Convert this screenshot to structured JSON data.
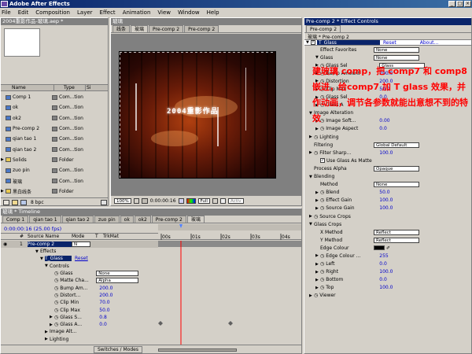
{
  "app": {
    "title": "Adobe After Effects"
  },
  "menu": [
    "File",
    "Edit",
    "Composition",
    "Layer",
    "Effect",
    "Animation",
    "View",
    "Window",
    "Help"
  ],
  "project": {
    "title": "2004重影作品-玻璃.aep *",
    "columns": [
      "Name",
      "Type",
      "Si"
    ],
    "items": [
      {
        "name": "Comp 1",
        "type": "Com...tion",
        "icon": "comp",
        "indent": 0
      },
      {
        "name": "ok",
        "type": "Com...tion",
        "icon": "comp",
        "indent": 0
      },
      {
        "name": "ok2",
        "type": "Com...tion",
        "icon": "comp",
        "indent": 0
      },
      {
        "name": "Pre-comp 2",
        "type": "Com...tion",
        "icon": "comp",
        "indent": 0
      },
      {
        "name": "qian tao 1",
        "type": "Com...tion",
        "icon": "comp",
        "indent": 0
      },
      {
        "name": "qian tao 2",
        "type": "Com...tion",
        "icon": "comp",
        "indent": 0
      },
      {
        "name": "Solids",
        "type": "Folder",
        "icon": "folder",
        "indent": 0
      },
      {
        "name": "zuo pin",
        "type": "Com...tion",
        "icon": "comp",
        "indent": 0
      },
      {
        "name": "玻璃",
        "type": "Com...tion",
        "icon": "comp",
        "indent": 0
      },
      {
        "name": "黑白线条",
        "type": "Folder",
        "icon": "folder",
        "indent": 0
      }
    ],
    "bottom_depth": "8 bpc"
  },
  "comp": {
    "title": "玻璃",
    "tabs": [
      "线条",
      "玻璃",
      "Pre-comp 2",
      "Pre-comp 2"
    ],
    "overlay_text": "2004重影作品",
    "zoom": "100%",
    "timecode": "0:00:00:16",
    "resolution": "Full",
    "active": "Activ"
  },
  "effect_controls": {
    "title": "Pre-comp 2 * Effect Controls",
    "tab": "Pre-comp 2",
    "subtitle": "玻璃 * Pre-comp 2",
    "header": {
      "label": "T_Glass",
      "reset": "Reset",
      "about": "About..."
    },
    "rows": [
      {
        "indent": 1,
        "label": "Effect Favorites",
        "sel": "None"
      },
      {
        "indent": 1,
        "tri": "▼",
        "label": "Glass",
        "sel": "None"
      },
      {
        "indent": 1,
        "tri": "▶",
        "label": "Glass Sel",
        "sel": "Glass"
      },
      {
        "indent": 1,
        "tri": "▶",
        "label": "Bump Amount",
        "val": "200.0"
      },
      {
        "indent": 1,
        "tri": "▶",
        "label": "Distortion",
        "val": "200.0"
      },
      {
        "indent": 1,
        "tri": "▶",
        "label": "Clip Max",
        "val": "50.0"
      },
      {
        "indent": 1,
        "tri": "▶",
        "label": "Glass Sel",
        "val": "0.0"
      },
      {
        "indent": 1,
        "tri": "▶",
        "label": "Glass A",
        "val": ""
      },
      {
        "indent": 0,
        "tri": "▼",
        "label": "Image Alteration",
        "val": ""
      },
      {
        "indent": 1,
        "tri": "▶",
        "label": "Image Soft...",
        "val": "0.00"
      },
      {
        "indent": 1,
        "tri": "▶",
        "label": "Image Aspect",
        "val": "0.0"
      },
      {
        "indent": 0,
        "tri": "▶",
        "label": "Lighting",
        "val": ""
      },
      {
        "indent": 0,
        "tri": "",
        "label": "Filtering",
        "sel": "Global Default"
      },
      {
        "indent": 0,
        "tri": "▶",
        "label": "Filter Sharp...",
        "val": "100.0"
      },
      {
        "indent": 1,
        "tri": "",
        "label": "",
        "chk": "Use Glass As Matte"
      },
      {
        "indent": 0,
        "tri": "",
        "label": "Process Alpha",
        "sel": "Opaque"
      },
      {
        "indent": 0,
        "tri": "▼",
        "label": "Blending",
        "val": ""
      },
      {
        "indent": 1,
        "tri": "",
        "label": "Method",
        "sel": "None"
      },
      {
        "indent": 1,
        "tri": "▶",
        "label": "Blend",
        "val": "50.0"
      },
      {
        "indent": 1,
        "tri": "▶",
        "label": "Effect Gain",
        "val": "100.0"
      },
      {
        "indent": 1,
        "tri": "▶",
        "label": "Source Gain",
        "val": "100.0"
      },
      {
        "indent": 0,
        "tri": "▶",
        "label": "Source Crops",
        "val": ""
      },
      {
        "indent": 0,
        "tri": "▼",
        "label": "Glass Crops",
        "val": ""
      },
      {
        "indent": 1,
        "tri": "",
        "label": "X Method",
        "sel": "Reflect"
      },
      {
        "indent": 1,
        "tri": "",
        "label": "Y Method",
        "sel": "Reflect"
      },
      {
        "indent": 1,
        "tri": "",
        "label": "Edge Colour",
        "sw": "#000000"
      },
      {
        "indent": 1,
        "tri": "▶",
        "label": "Edge Colour ...",
        "val": "255"
      },
      {
        "indent": 1,
        "tri": "▶",
        "label": "Left",
        "val": "0.0"
      },
      {
        "indent": 1,
        "tri": "▶",
        "label": "Right",
        "val": "100.0"
      },
      {
        "indent": 1,
        "tri": "▶",
        "label": "Bottom",
        "val": "0.0"
      },
      {
        "indent": 1,
        "tri": "▶",
        "label": "Top",
        "val": "100.0"
      },
      {
        "indent": 0,
        "tri": "▶",
        "label": "Viewer",
        "val": ""
      }
    ],
    "annotation": "建玻璃 comp，把 comp7 和 comp8 嵌进，给comp7 加 T glass 效果，并作动画，调节各参数就能出意想不到的特效"
  },
  "timeline": {
    "title": "玻璃 * Timeline",
    "tabs": [
      "Comp 1",
      "qian tao 1",
      "qian tao 2",
      "zuo pin",
      "ok",
      "ok2",
      "Pre-comp 2",
      "玻璃"
    ],
    "time": "0:00:00:16 (25.00 fps)",
    "columns": [
      "#",
      "Source Name",
      "Mode",
      "T",
      "TrkMat"
    ],
    "ruler": [
      "00s",
      "01s",
      "02s",
      "03s",
      "04s"
    ],
    "layer": {
      "num": "1",
      "name": "Pre-comp 2",
      "mode": "N"
    },
    "props": [
      {
        "indent": 0,
        "tri": "▼",
        "label": "Effects",
        "val": ""
      },
      {
        "indent": 1,
        "tri": "▼",
        "label": "T_Glass",
        "val": "Reset",
        "blue": true
      },
      {
        "indent": 2,
        "tri": "▼",
        "label": "Controls",
        "val": ""
      },
      {
        "indent": 3,
        "tri": "",
        "label": "Glass",
        "sel": "None"
      },
      {
        "indent": 3,
        "tri": "",
        "label": "Matte Cha...",
        "sel": "Alpha"
      },
      {
        "indent": 3,
        "tri": "",
        "label": "Bump Am...",
        "val": "200.0"
      },
      {
        "indent": 3,
        "tri": "",
        "label": "Distort...",
        "val": "200.0"
      },
      {
        "indent": 3,
        "tri": "",
        "label": "Clip Min",
        "val": "70.0"
      },
      {
        "indent": 3,
        "tri": "",
        "label": "Clip Max",
        "val": "50.0"
      },
      {
        "indent": 3,
        "tri": "▶",
        "label": "Glass S...",
        "val": "0.8"
      },
      {
        "indent": 3,
        "tri": "▶",
        "label": "Glass A...",
        "val": "0.0"
      },
      {
        "indent": 2,
        "tri": "▶",
        "label": "Image Alt...",
        "val": ""
      },
      {
        "indent": 2,
        "tri": "▶",
        "label": "Lighting",
        "val": ""
      }
    ],
    "switches_label": "Switches / Modes"
  },
  "colors": {
    "accent": "#0a246a",
    "annotation": "#ff0000",
    "timeline_marker": "#ff0000"
  }
}
